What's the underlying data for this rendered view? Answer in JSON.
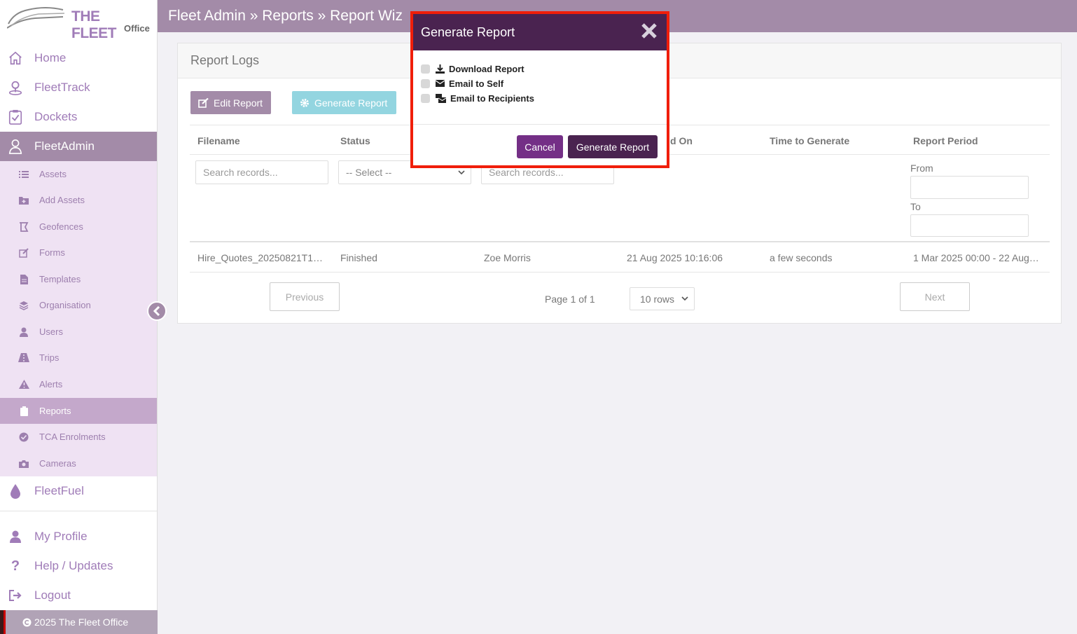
{
  "brand": {
    "name": "THE FLEET",
    "sub": "Office"
  },
  "header": {
    "breadcrumb": "Fleet Admin » Reports » Report Wiz"
  },
  "sidebar": {
    "main_top": [
      {
        "label": "Home",
        "icon": "home-icon"
      },
      {
        "label": "FleetTrack",
        "icon": "map-pin-icon"
      },
      {
        "label": "Dockets",
        "icon": "clipboard-check-icon"
      },
      {
        "label": "FleetAdmin",
        "icon": "user-admin-icon"
      }
    ],
    "sub": [
      {
        "label": "Assets",
        "icon": "list-icon"
      },
      {
        "label": "Add Assets",
        "icon": "folder-plus-icon"
      },
      {
        "label": "Geofences",
        "icon": "geofence-icon"
      },
      {
        "label": "Forms",
        "icon": "edit-icon"
      },
      {
        "label": "Templates",
        "icon": "file-icon"
      },
      {
        "label": "Organisation",
        "icon": "layers-icon"
      },
      {
        "label": "Users",
        "icon": "user-icon"
      },
      {
        "label": "Trips",
        "icon": "road-icon"
      },
      {
        "label": "Alerts",
        "icon": "warning-icon"
      },
      {
        "label": "Reports",
        "icon": "clipboard-icon"
      },
      {
        "label": "TCA Enrolments",
        "icon": "check-circle-icon"
      },
      {
        "label": "Cameras",
        "icon": "camera-icon"
      }
    ],
    "fuel": {
      "label": "FleetFuel",
      "icon": "droplet-icon"
    },
    "bottom": [
      {
        "label": "My Profile",
        "icon": "user-icon"
      },
      {
        "label": "Help / Updates",
        "icon": "question-icon"
      },
      {
        "label": "Logout",
        "icon": "logout-icon"
      }
    ],
    "footer": "2025 The Fleet Office"
  },
  "card": {
    "title": "Report Logs",
    "edit_label": "Edit Report",
    "generate_label": "Generate Report",
    "columns": [
      "Filename",
      "Status",
      "",
      "d On",
      "Time to Generate",
      "Report Period"
    ],
    "filters": {
      "filename_placeholder": "Search records...",
      "status_select": "-- Select --",
      "third_placeholder": "Search records...",
      "from_label": "From",
      "to_label": "To"
    },
    "rows": [
      [
        "Hire_Quotes_20250821T1…",
        "Finished",
        "Zoe Morris",
        "21 Aug 2025 10:16:06",
        "a few seconds",
        "1 Mar 2025 00:00 - 22 Aug…"
      ]
    ],
    "pager": {
      "previous": "Previous",
      "next": "Next",
      "page_info": "Page 1 of 1",
      "rows": "10 rows"
    }
  },
  "modal": {
    "title": "Generate Report",
    "options": [
      {
        "label": "Download Report",
        "icon": "download-icon"
      },
      {
        "label": "Email to Self",
        "icon": "envelope-icon"
      },
      {
        "label": "Email to Recipients",
        "icon": "mail-group-icon"
      }
    ],
    "cancel": "Cancel",
    "generate": "Generate Report"
  }
}
